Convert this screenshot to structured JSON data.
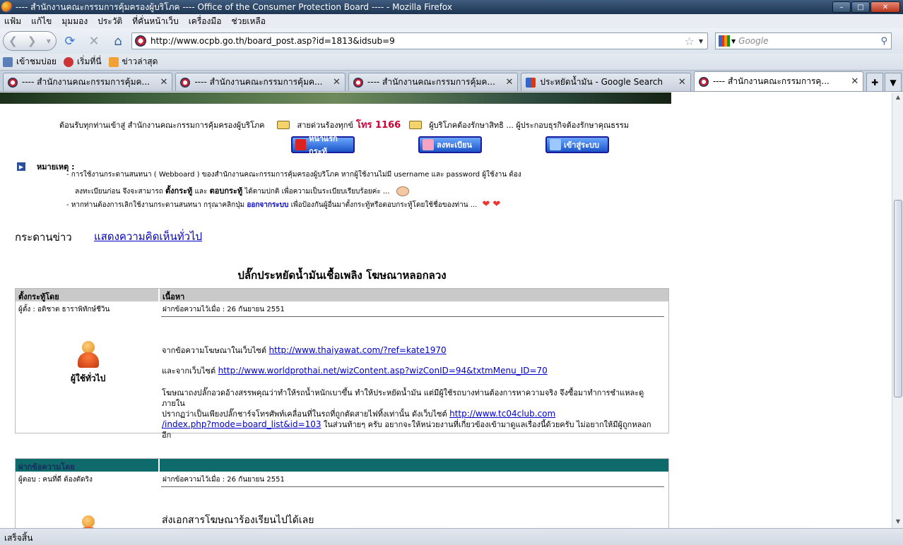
{
  "window": {
    "title": "---- สำนักงานคณะกรรมการคุ้มครองผู้บริโภค ---- Office of the Consumer Protection Board ---- - Mozilla Firefox"
  },
  "menu": [
    "แฟ้ม",
    "แก้ไข",
    "มุมมอง",
    "ประวัติ",
    "ที่คั่นหน้าเว็บ",
    "เครื่องมือ",
    "ช่วยเหลือ"
  ],
  "nav": {
    "url": "http://www.ocpb.go.th/board_post.asp?id=1813&idsub=9",
    "search_placeholder": "Google"
  },
  "bookmarks": [
    "เข้าชมบ่อย",
    "เริ่มที่นี่",
    "ข่าวล่าสุด"
  ],
  "tabs": [
    {
      "label": "---- สำนักงานคณะกรรมการคุ้มค...",
      "active": false,
      "icon": "ocpb"
    },
    {
      "label": "---- สำนักงานคณะกรรมการคุ้มค...",
      "active": false,
      "icon": "ocpb"
    },
    {
      "label": "---- สำนักงานคณะกรรมการคุ้มค...",
      "active": false,
      "icon": "ocpb"
    },
    {
      "label": "ประหยัดน้ำมัน - Google Search",
      "active": false,
      "icon": "google"
    },
    {
      "label": "---- สำนักงานคณะกรรมการคุ...",
      "active": true,
      "icon": "ocpb"
    }
  ],
  "page": {
    "welcome": {
      "part1": "ต้อนรับทุกท่านเข้าสู่ สำนักงานคณะกรรมการคุ้มครองผู้บริโภค",
      "part2": "สายด่วนร้องทุกข์",
      "hotline": "โทร 1166",
      "part3": "ผู้บริโภคต้องรักษาสิทธิ ... ผู้ประกอบธุรกิจต้องรักษาคุณธรรม"
    },
    "buttons": {
      "home": "หน้าแรกกระทู้",
      "register": "ลงทะเบียน",
      "login": "เข้าสู่ระบบ"
    },
    "note": {
      "title": "หมายเหตุ :",
      "line1": "- การใช้งานกระดานสนทนา ( Webboard ) ของสำนักงานคณะกรรมการคุ้มครองผู้บริโภค หากผู้ใช้งานไม่มี username และ password ผู้ใช้งาน ต้อง",
      "line2a": "ลงทะเบียนก่อน จึงจะสามารถ",
      "line2b": "ตั้งกระทู้",
      "line2c": "และ",
      "line2d": "ตอบกระทู้",
      "line2e": "ได้ตามปกติ เพื่อความเป็นระเบียบเรียบร้อยค่ะ ...",
      "line3a": "- หากท่านต้องการเลิกใช้งานกระดานสนทนา กรุณาคลิกปุ่ม",
      "line3link": "ออกจากระบบ",
      "line3b": "เพื่อป้องกันผู้อื่นมาตั้งกระทู้หรือตอบกระทู้โดยใช้ชื่อของท่าน ..."
    },
    "board_title": "กระดานข่าว",
    "board_link": "แสดงความคิดเห็นทั่วไป",
    "topic": "ปลั๊กประหยัดน้ำมันเชื้อเพลิง โฆษณาหลอกลวง",
    "posts": [
      {
        "col1": "ตั้งกระทู้โดย",
        "col2": "เนื้อหา",
        "author": "ผู้ตั้ง : อดิชาต ธาราพิทักษ์ชีวิน",
        "date": "ฝากข้อความไว้เมื่อ : 26 กันยายน 2551",
        "role": "ผู้ใช้ทั่วไป",
        "p1": "จากข้อความโฆษณาในเว็บไซต์",
        "p1link": "http://www.thaiyawat.com/?ref=kate1970",
        "p2": "และจากเว็บไซต์",
        "p2link": "http://www.worldprothai.net/wizContent.asp?wizConID=94&txtmMenu_ID=70",
        "p3a": "โฆษณาถงปลั๊กอวดอ้างสรรพคุณว่าทำให้รถน้ำหนักเบาขึ้น ทำให้ประหยัดน้ำมัน แต่มีผู้ใช้รถบางท่านต้องการหาความจริง จึงซื้อมาทำการชำแหละดูภายใน",
        "p3b": "ปรากฏว่าเป็นเพียงปลั๊กชาร์จโทรศัพท์เคลื่อนที่ในรถที่ถูกตัดสายไฟทิ้งเท่านั้น ดังเว็บไซต์",
        "p3link1": "http://www.tc04club.com",
        "p3link2": "/index.php?mode=board_list&id=103",
        "p3c": "ในส่วนท้ายๆ ครับ อยากจะให้หน่วยงานที่เกี่ยวข้องเข้ามาดูแลเรื่องนี้ด้วยครับ ไม่อยากให้มีผู้ถูกหลอกอีก"
      },
      {
        "col1": "ฝากข้อความโดย",
        "col2": "",
        "author": "ผู้ตอบ : คนที่ดี ต้องตัดริง",
        "date": "ฝากข้อความไว้เมื่อ : 26 กันยายน 2551",
        "body": "ส่งเอกสารโฆษณาร้องเรียนไปได้เลย"
      }
    ]
  },
  "status": "เสร็จสิ้น"
}
